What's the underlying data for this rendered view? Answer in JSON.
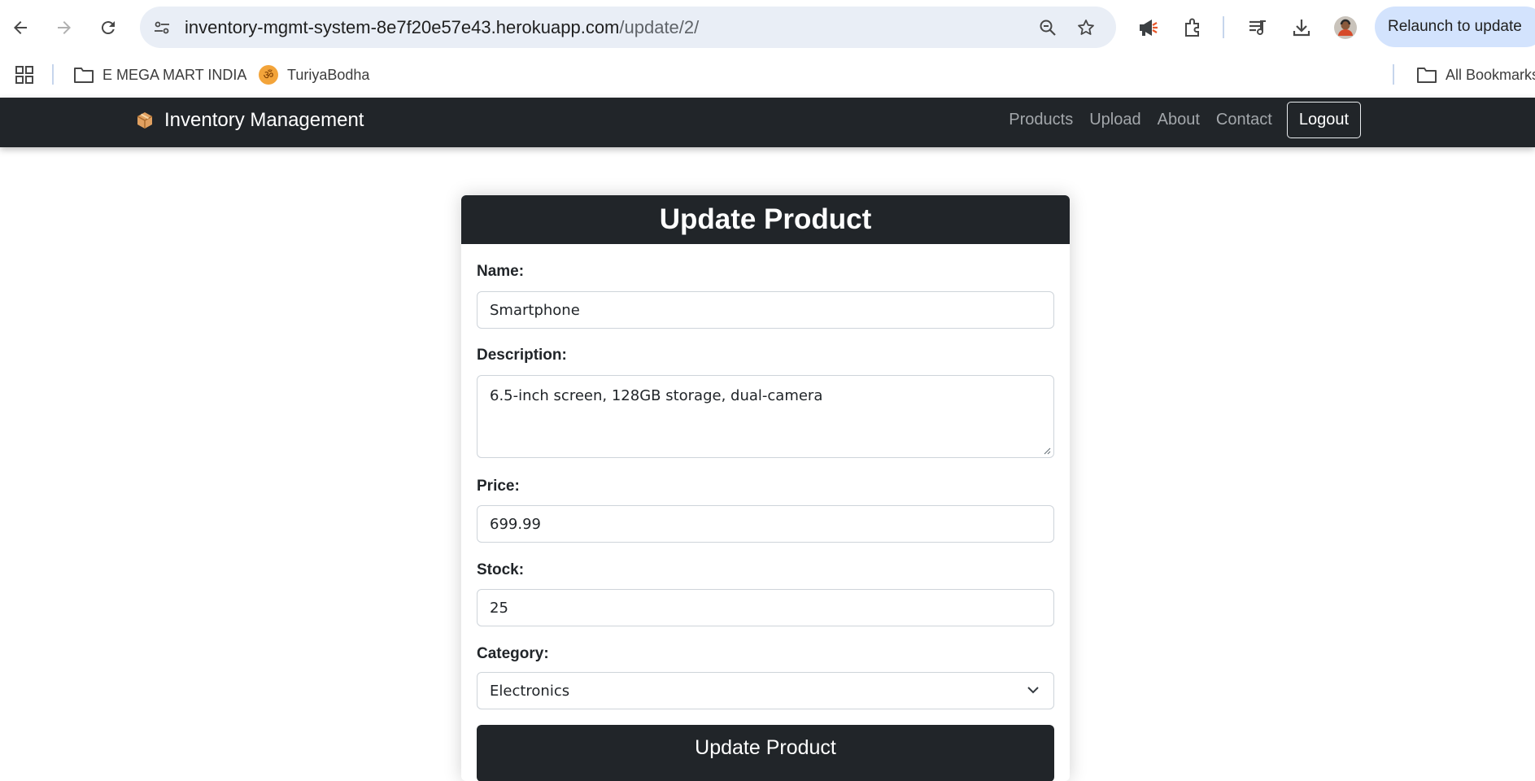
{
  "browser": {
    "url_host": "inventory-mgmt-system-8e7f20e57e43.herokuapp.com",
    "url_path": "/update/2/",
    "relaunch_label": "Relaunch to update"
  },
  "bookmarks": {
    "items": [
      {
        "label": "E MEGA MART INDIA"
      },
      {
        "label": "TuriyaBodha"
      }
    ],
    "all_bookmarks_label": "All Bookmarks"
  },
  "navbar": {
    "brand": "Inventory Management",
    "links": [
      "Products",
      "Upload",
      "About",
      "Contact"
    ],
    "logout_label": "Logout"
  },
  "form": {
    "title": "Update Product",
    "name_label": "Name:",
    "name_value": "Smartphone",
    "description_label": "Description:",
    "description_value": "6.5-inch screen, 128GB storage, dual-camera",
    "price_label": "Price:",
    "price_value": "699.99",
    "stock_label": "Stock:",
    "stock_value": "25",
    "category_label": "Category:",
    "category_value": "Electronics",
    "submit_label": "Update Product"
  },
  "colors": {
    "navbar_bg": "#212529",
    "omnibox_bg": "#e9eef6",
    "relaunch_bg": "#d3e3fd"
  }
}
